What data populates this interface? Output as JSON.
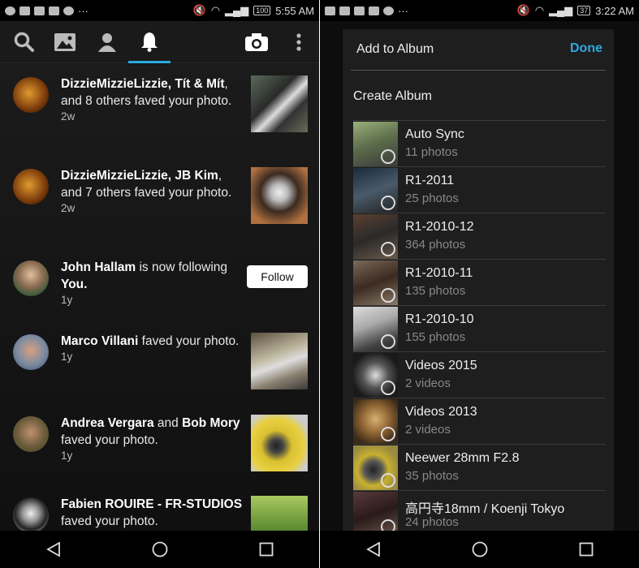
{
  "left": {
    "status": {
      "time": "5:55 AM",
      "battery": "100"
    },
    "feed": [
      {
        "name": "DizzieMizzieLizzie",
        "extra": ", Tít & Mít",
        "rest": ", and 8 others faved your photo.",
        "time": "2w"
      },
      {
        "name": "DizzieMizzieLizzie",
        "extra": ", JB Kim",
        "rest": ", and 7 others faved your photo.",
        "time": "2w"
      },
      {
        "name": "John Hallam",
        "extra": "",
        "rest": " is now following ",
        "rest_bold": "You.",
        "time": "1y",
        "follow_label": "Follow"
      },
      {
        "name": "Marco Villani",
        "extra": "",
        "rest": " faved your photo.",
        "time": "1y"
      },
      {
        "name": "Andrea Vergara",
        "extra": " and ",
        "name2": "Bob Mory",
        "rest": " faved your photo.",
        "time": "1y"
      },
      {
        "name": "Fabien ROUIRE - FR-STUDIOS",
        "extra": "",
        "rest": " faved your photo.",
        "time": ""
      }
    ],
    "tabs": [
      "search-icon",
      "photos-icon",
      "contacts-icon",
      "notifications-icon",
      "camera-icon",
      "more-icon"
    ]
  },
  "right": {
    "status": {
      "time": "3:22 AM",
      "battery": "37"
    },
    "dialog": {
      "title": "Add to Album",
      "done": "Done",
      "create": "Create Album",
      "albums": [
        {
          "name": "Auto Sync",
          "count": "11 photos",
          "color": "#7a8a6a"
        },
        {
          "name": "R1-2011",
          "count": "25 photos",
          "color": "#2f3a44"
        },
        {
          "name": "R1-2010-12",
          "count": "364 photos",
          "color": "#4a3a30"
        },
        {
          "name": "R1-2010-11",
          "count": "135 photos",
          "color": "#5a4a3a"
        },
        {
          "name": "R1-2010-10",
          "count": "155 photos",
          "color": "#9a9a9a"
        },
        {
          "name": "Videos 2015",
          "count": "2 videos",
          "color": "#3a3a3a"
        },
        {
          "name": "Videos 2013",
          "count": "2 videos",
          "color": "#8a6a3a"
        },
        {
          "name": "Neewer 28mm F2.8",
          "count": "35 photos",
          "color": "#8a7a2a"
        },
        {
          "name": "高円寺18mm / Koenji Tokyo",
          "count": "24 photos",
          "color": "#4a3a3a"
        }
      ]
    }
  }
}
